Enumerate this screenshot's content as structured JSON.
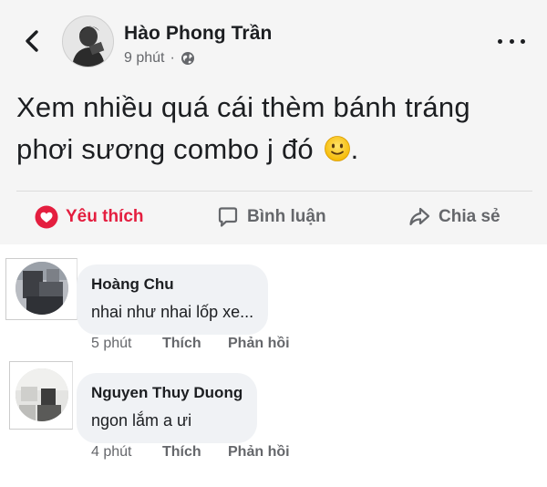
{
  "post": {
    "author": "Hào Phong Trần",
    "time": "9 phút",
    "separator": "·",
    "privacy_icon": "globe-icon",
    "text_line1": "Xem nhiều quá cái thèm bánh tráng",
    "text_line2": "phơi sương combo j đó",
    "emoji": "slightly-smiling-face",
    "more_icon": "more-horizontal-icon",
    "back_icon": "chevron-left-icon"
  },
  "actions": {
    "like": "Yêu thích",
    "comment": "Bình luận",
    "share": "Chia sẻ"
  },
  "colors": {
    "love": "#e41e3f",
    "secondary_text": "#65676b",
    "bubble": "#f0f2f5",
    "post_bg": "#f5f5f5"
  },
  "comments": [
    {
      "name": "Hoàng Chu",
      "text": "nhai như nhai lốp xe...",
      "time": "5 phút",
      "like": "Thích",
      "reply": "Phản hồi"
    },
    {
      "name": "Nguyen Thuy Duong",
      "text": "ngon lắm a ưi",
      "time": "4 phút",
      "like": "Thích",
      "reply": "Phản hồi"
    }
  ]
}
